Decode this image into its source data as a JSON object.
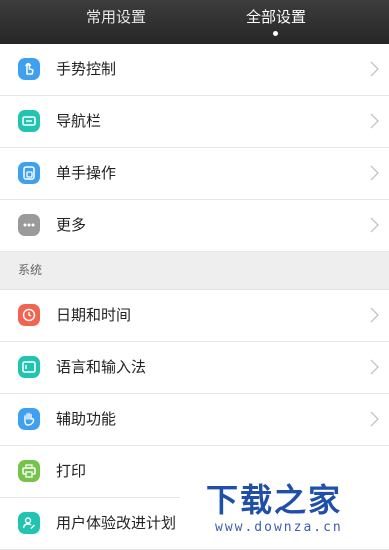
{
  "tabs": [
    {
      "label": "常用设置",
      "active": false
    },
    {
      "label": "全部设置",
      "active": true
    }
  ],
  "group1": [
    {
      "label": "手势控制",
      "icon": "gesture-hand-icon",
      "color": "#3fa0f0"
    },
    {
      "label": "导航栏",
      "icon": "navigation-bar-icon",
      "color": "#22c4b1"
    },
    {
      "label": "单手操作",
      "icon": "one-hand-icon",
      "color": "#3fa0f0"
    },
    {
      "label": "更多",
      "icon": "more-dots-icon",
      "color": "#9a9a9a"
    }
  ],
  "section_title": "系统",
  "group2": [
    {
      "label": "日期和时间",
      "icon": "clock-icon",
      "color": "#f06450"
    },
    {
      "label": "语言和输入法",
      "icon": "keyboard-icon",
      "color": "#22c4b1"
    },
    {
      "label": "辅助功能",
      "icon": "accessibility-hand-icon",
      "color": "#3fa0f0"
    },
    {
      "label": "打印",
      "icon": "printer-icon",
      "color": "#74c44a"
    },
    {
      "label": "用户体验改进计划",
      "icon": "user-experience-icon",
      "color": "#22c4b1"
    }
  ],
  "watermark": {
    "title": "下载之家",
    "url": "www.downza.cn"
  }
}
